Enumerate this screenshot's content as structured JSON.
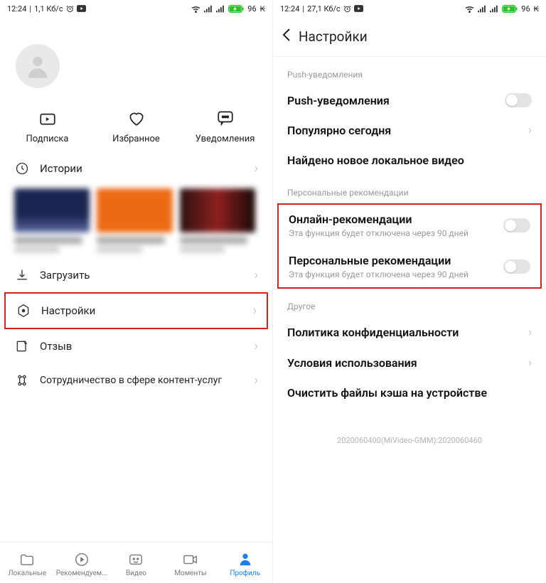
{
  "status": {
    "time": "12:24",
    "speed_left": "1,1 Кб/с",
    "speed_right": "27,1 Кб/с",
    "battery": "96",
    "battery_suffix": "₭"
  },
  "left": {
    "actions": {
      "subscribe": "Подписка",
      "favorites": "Избранное",
      "notifications": "Уведомления"
    },
    "history": "Истории",
    "menu": {
      "download": "Загрузить",
      "settings": "Настройки",
      "feedback": "Отзыв",
      "cooperation": "Сотрудничество в сфере контент-услуг"
    },
    "nav": {
      "local": "Локальные",
      "recommended": "Рекомендуем...",
      "video": "Видео",
      "moments": "Моменты",
      "profile": "Профиль"
    }
  },
  "right": {
    "header": "Настройки",
    "sections": {
      "push_header": "Push-уведомления",
      "push": "Push-уведомления",
      "popular": "Популярно сегодня",
      "found_local": "Найдено новое локальное видео",
      "personal_header": "Персональные рекомендации",
      "online_rec": "Онлайн-рекомендации",
      "online_rec_sub": "Эта функция будет отключена через 90 дней",
      "personal_rec": "Персональные рекомендации",
      "personal_rec_sub": "Эта функция будет отключена через 90 дней",
      "other_header": "Другое",
      "privacy": "Политика конфиденциальности",
      "terms": "Условия использования",
      "clear_cache": "Очистить файлы кэша на устройстве"
    },
    "build": "2020060400(MiVideo-GMM):2020060460"
  }
}
